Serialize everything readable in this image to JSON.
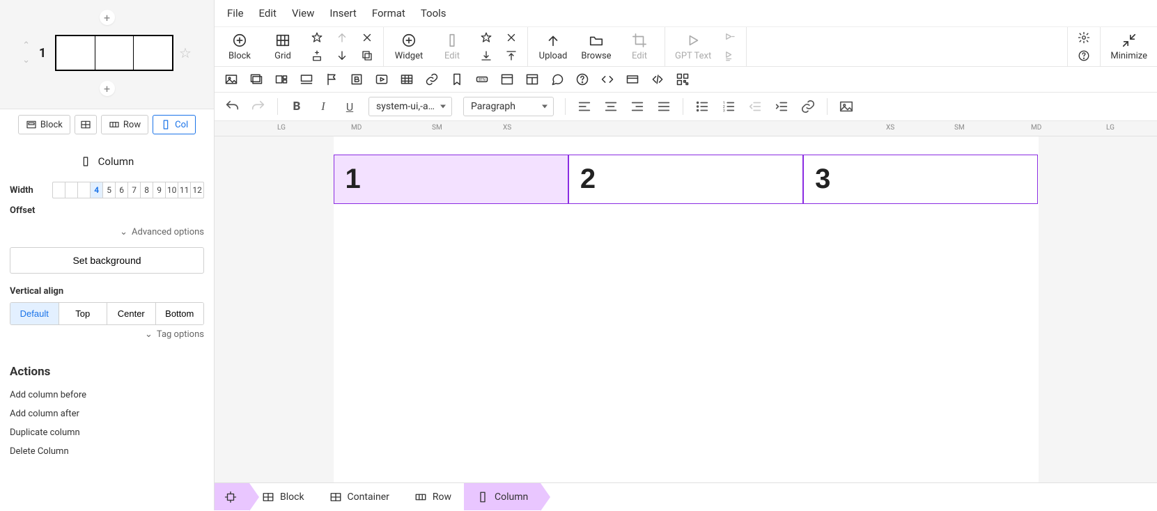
{
  "sidebar": {
    "block_index": "1",
    "tabs": {
      "block": "Block",
      "row": "Row",
      "col": "Col"
    },
    "panel_title": "Column",
    "width_label": "Width",
    "offset_label": "Offset",
    "width_cells": [
      "",
      "",
      "",
      "4",
      "5",
      "6",
      "7",
      "8",
      "9",
      "10",
      "11",
      "12"
    ],
    "width_selected": "4",
    "advanced": "Advanced options",
    "set_background": "Set background",
    "valign_label": "Vertical align",
    "valign": {
      "default": "Default",
      "top": "Top",
      "center": "Center",
      "bottom": "Bottom"
    },
    "tag_options": "Tag options",
    "actions_head": "Actions",
    "actions": {
      "add_before": "Add column before",
      "add_after": "Add column after",
      "duplicate": "Duplicate column",
      "delete": "Delete Column"
    }
  },
  "menubar": {
    "file": "File",
    "edit": "Edit",
    "view": "View",
    "insert": "Insert",
    "format": "Format",
    "tools": "Tools"
  },
  "toolbar": {
    "block": "Block",
    "grid": "Grid",
    "widget": "Widget",
    "edit": "Edit",
    "upload": "Upload",
    "browse": "Browse",
    "gpt": "GPT Text",
    "minimize": "Minimize"
  },
  "text_toolbar": {
    "font": "system-ui,-ap…",
    "style": "Paragraph"
  },
  "ruler": {
    "lg_l": "LG",
    "md_l": "MD",
    "sm_l": "SM",
    "xs_l": "XS",
    "xs_r": "XS",
    "sm_r": "SM",
    "md_r": "MD",
    "lg_r": "LG"
  },
  "canvas": {
    "cols": [
      "1",
      "2",
      "3"
    ]
  },
  "breadcrumb": {
    "block": "Block",
    "container": "Container",
    "row": "Row",
    "column": "Column"
  }
}
